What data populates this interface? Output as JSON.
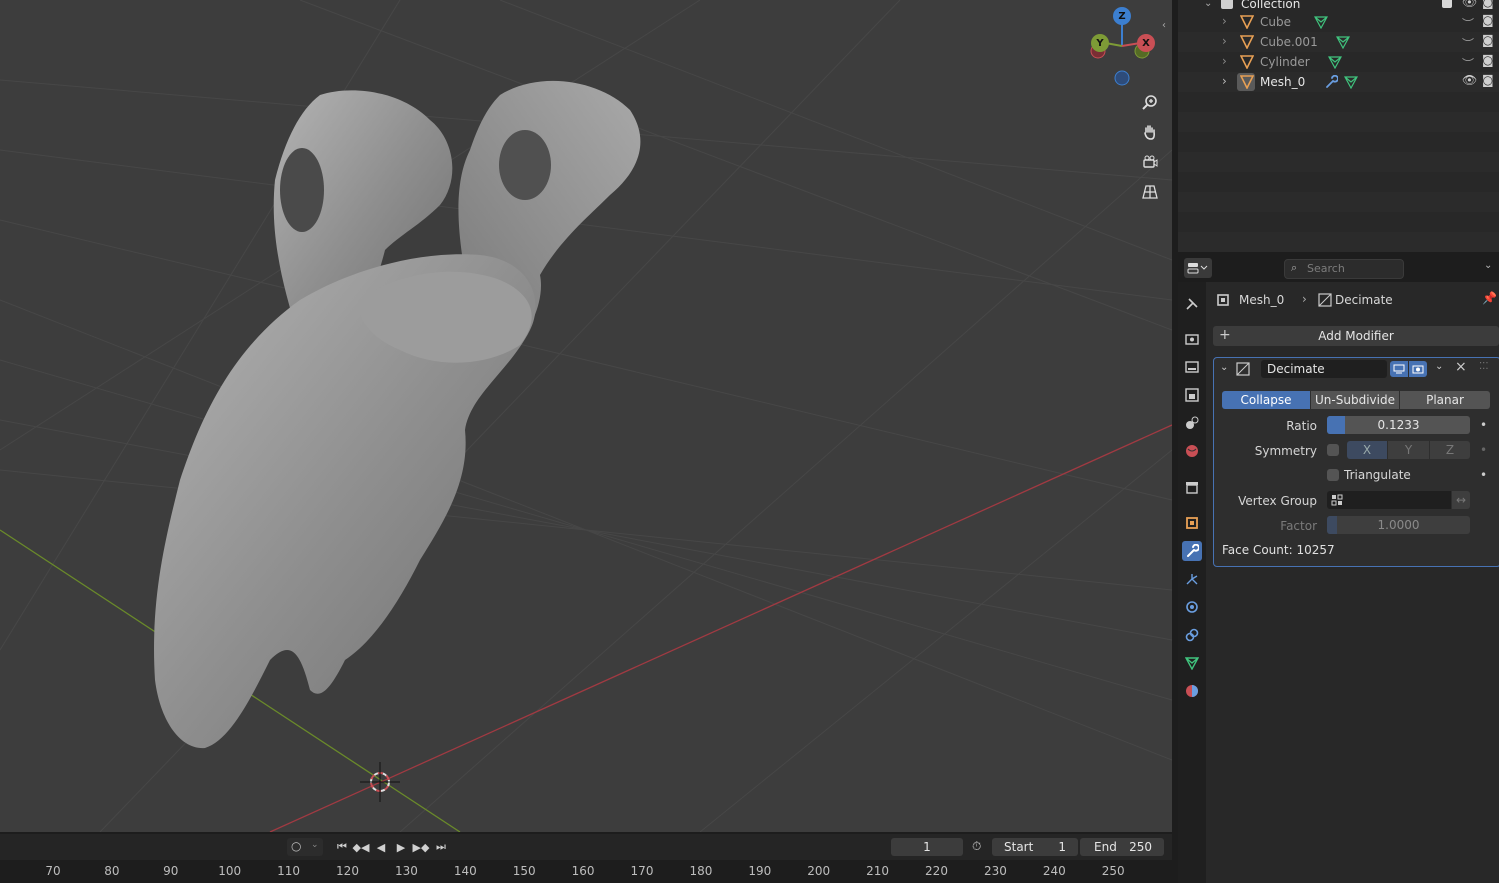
{
  "outliner": {
    "collection_label": "Collection",
    "items": [
      {
        "label": "Cube"
      },
      {
        "label": "Cube.001"
      },
      {
        "label": "Cylinder"
      },
      {
        "label": "Mesh_0"
      }
    ]
  },
  "properties": {
    "search_placeholder": "Search",
    "breadcrumb_object": "Mesh_0",
    "breadcrumb_modifier": "Decimate",
    "add_modifier_label": "Add Modifier",
    "modifier": {
      "name": "Decimate",
      "modes": [
        "Collapse",
        "Un-Subdivide",
        "Planar"
      ],
      "active_mode": "Collapse",
      "ratio_label": "Ratio",
      "ratio_value": "0.1233",
      "ratio_fraction": 0.1233,
      "symmetry_label": "Symmetry",
      "axes": [
        "X",
        "Y",
        "Z"
      ],
      "triangulate_label": "Triangulate",
      "vertex_group_label": "Vertex Group",
      "factor_label": "Factor",
      "factor_value": "1.0000",
      "face_count": "Face Count: 10257"
    }
  },
  "gizmo": {
    "z": "Z",
    "y": "Y",
    "x": "X"
  },
  "timeline": {
    "current_frame": "1",
    "start_label": "Start",
    "start_value": "1",
    "end_label": "End",
    "end_value": "250",
    "ruler_ticks": [
      "70",
      "80",
      "90",
      "100",
      "110",
      "120",
      "130",
      "140",
      "150",
      "160",
      "170",
      "180",
      "190",
      "200",
      "210",
      "220",
      "230",
      "240",
      "250"
    ]
  },
  "colors": {
    "accent": "#4772b3",
    "x_axis": "#c94f55",
    "y_axis": "#7d9b36",
    "z_axis": "#3c7fd0",
    "mesh_icon": "#e8a055",
    "data_icon": "#40c47e"
  }
}
